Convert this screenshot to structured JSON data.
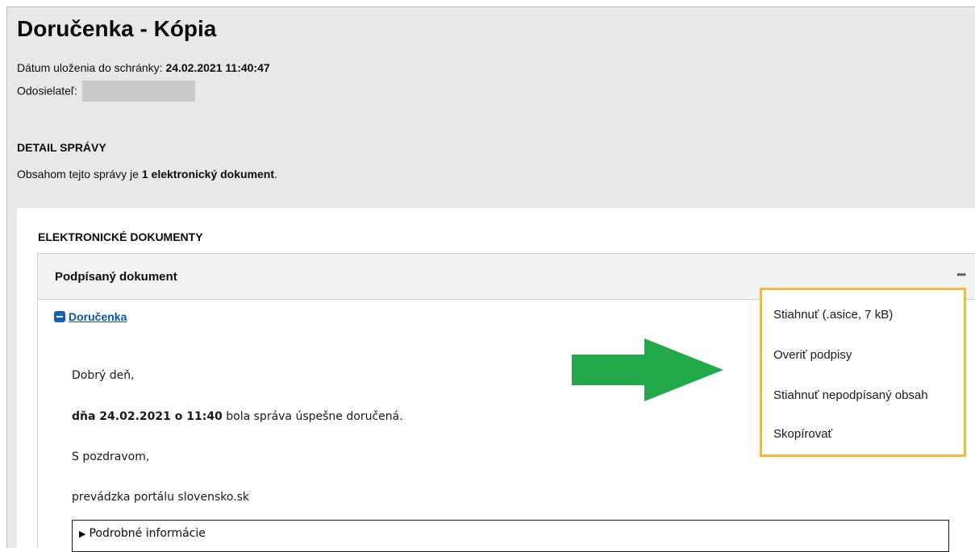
{
  "header": {
    "title": "Doručenka - Kópia",
    "saved_label": "Dátum uloženia do schránky:",
    "saved_value": "24.02.2021 11:40:47",
    "sender_label": "Odosielateľ:"
  },
  "detail": {
    "heading": "DETAIL SPRÁVY",
    "text_prefix": "Obsahom tejto správy je ",
    "text_bold": "1 elektronický dokument",
    "text_suffix": "."
  },
  "documents": {
    "heading": "ELEKTRONICKÉ DOKUMENTY",
    "card_title": "Podpísaný dokument",
    "more_icon": "•••",
    "link_label": "Doručenka"
  },
  "message": {
    "greeting": "Dobrý deň,",
    "bold_part": "dňa 24.02.2021 o 11:40",
    "rest": " bola správa úspešne doručená.",
    "regards": "S pozdravom,",
    "signature": "prevádzka portálu slovensko.sk",
    "details_toggle": "Podrobné informácie"
  },
  "menu": {
    "items": [
      "Stiahnuť (.asice, 7 kB)",
      "Overiť podpisy",
      "Stiahnuť nepodpísaný obsah",
      "Skopírovať"
    ]
  },
  "colors": {
    "arrow": "#22aa4a",
    "menu_border": "#f4b83a",
    "link": "#0b57a4"
  }
}
